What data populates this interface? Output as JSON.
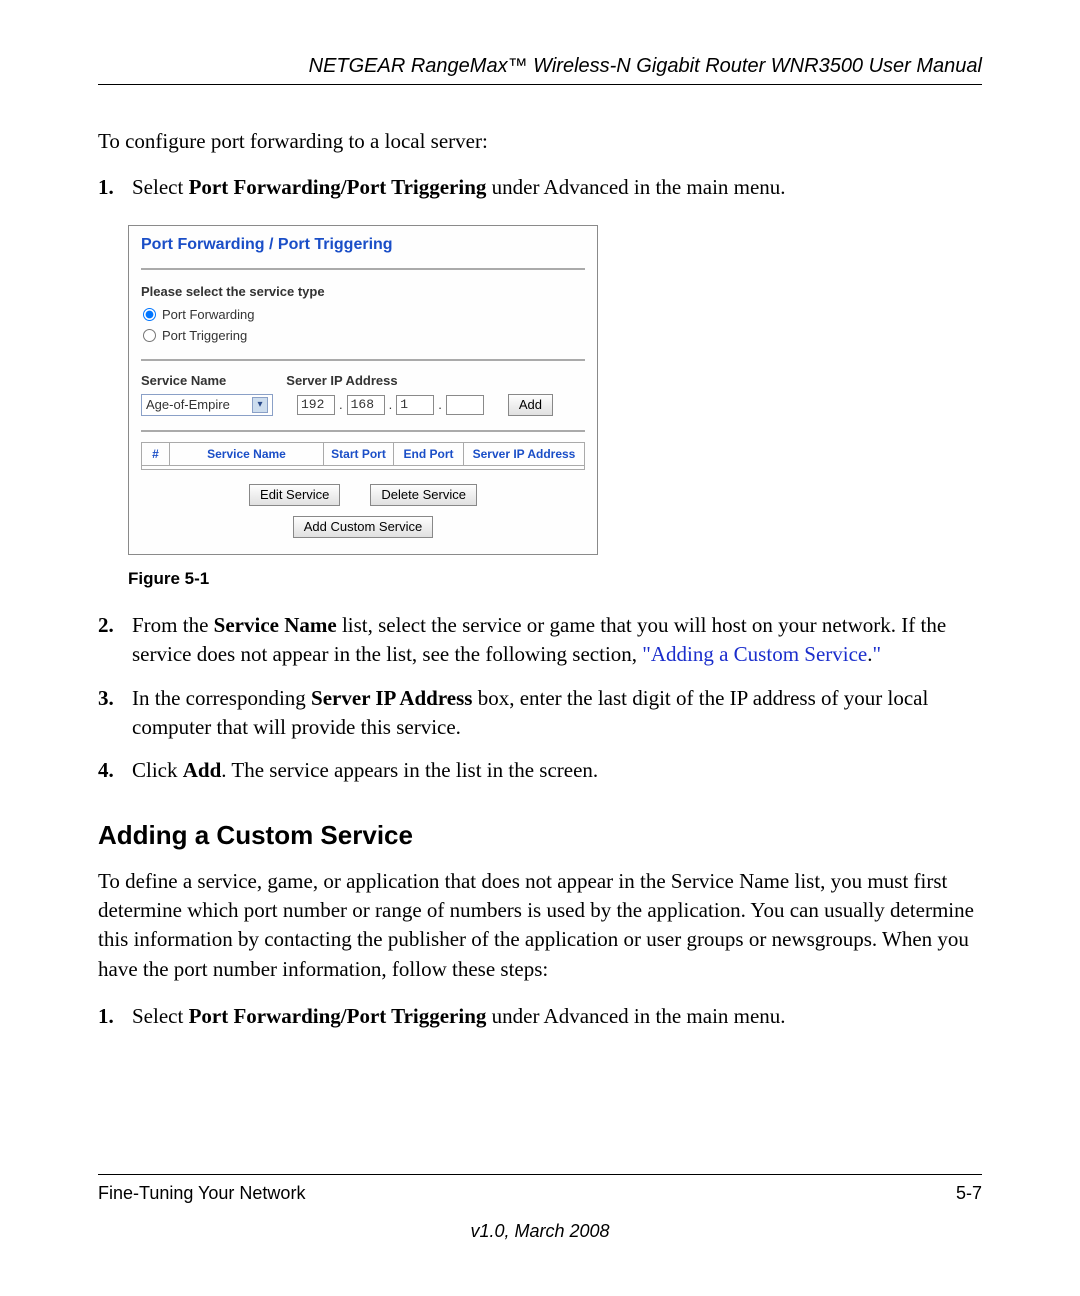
{
  "header": "NETGEAR RangeMax™ Wireless-N Gigabit Router WNR3500 User Manual",
  "intro": "To configure port forwarding to a local server:",
  "steps_a": [
    {
      "num": "1.",
      "pre": "Select ",
      "bold": "Port Forwarding/Port Triggering",
      "post": " under Advanced in the main menu."
    }
  ],
  "screenshot": {
    "title": "Port Forwarding / Port Triggering",
    "select_label": "Please select the service type",
    "radio1": "Port Forwarding",
    "radio2": "Port Triggering",
    "svc_name_label": "Service Name",
    "svc_ip_label": "Server IP Address",
    "svc_name_value": "Age-of-Empire",
    "ip": {
      "a": "192",
      "b": "168",
      "c": "1",
      "d": ""
    },
    "add_btn": "Add",
    "cols": {
      "n": "#",
      "name": "Service Name",
      "start": "Start Port",
      "end": "End Port",
      "ip": "Server IP Address"
    },
    "btn_edit": "Edit Service",
    "btn_delete": "Delete Service",
    "btn_custom": "Add Custom Service"
  },
  "fig_caption": "Figure 5-1",
  "steps_b": [
    {
      "num": "2.",
      "html": "From the <b>Service Name</b> list, select the service or game that you will host on your network. If the service does not appear in the list, see the following section, <span class=\"crossref\">\"Adding a Custom Service</span>.<span class=\"crossref\">\"</span>"
    },
    {
      "num": "3.",
      "html": "In the corresponding <b>Server IP Address</b> box, enter the last digit of the IP address of your local computer that will provide this service."
    },
    {
      "num": "4.",
      "html": "Click <b>Add</b>. The service appears in the list in the screen."
    }
  ],
  "h2": "Adding a Custom Service",
  "para2": "To define a service, game, or application that does not appear in the Service Name list, you must first determine which port number or range of numbers is used by the application. You can usually determine this information by contacting the publisher of the application or user groups or newsgroups. When you have the port number information, follow these steps:",
  "steps_c": [
    {
      "num": "1.",
      "pre": "Select ",
      "bold": "Port Forwarding/Port Triggering",
      "post": " under Advanced in the main menu."
    }
  ],
  "footer": {
    "section": "Fine-Tuning Your Network",
    "page": "5-7",
    "version": "v1.0, March 2008"
  }
}
